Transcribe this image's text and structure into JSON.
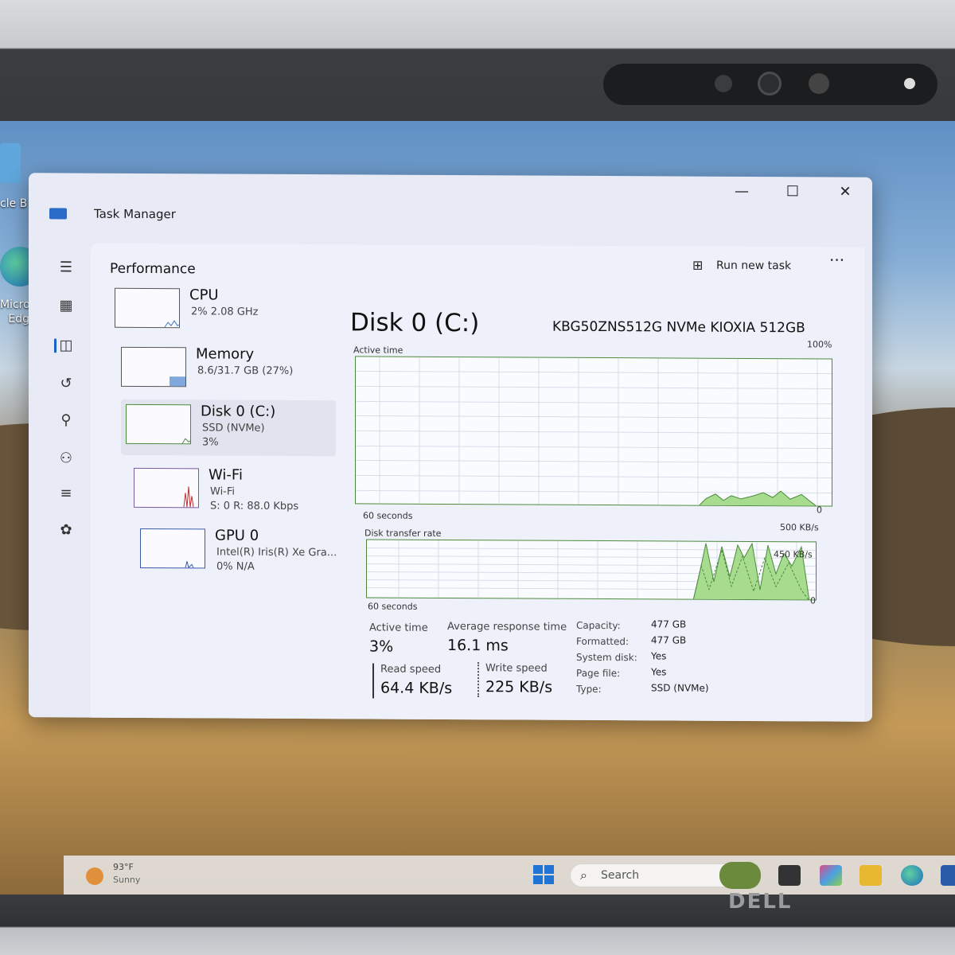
{
  "window": {
    "title": "Task Manager",
    "minimize": "—",
    "maximize": "☐",
    "close": "✕"
  },
  "desktop": {
    "icons": [
      {
        "label": "cle B"
      },
      {
        "label": "Microsoft Edge"
      }
    ]
  },
  "header": {
    "page_title": "Performance",
    "run_new_task": "Run new task",
    "more": "···"
  },
  "nav": {
    "icons": [
      "menu-icon",
      "processes-icon",
      "performance-icon",
      "app-history-icon",
      "startup-apps-icon",
      "users-icon",
      "details-icon",
      "services-icon",
      "settings-icon"
    ]
  },
  "resources": [
    {
      "name": "CPU",
      "sub1": "2%  2.08 GHz",
      "sub2": ""
    },
    {
      "name": "Memory",
      "sub1": "8.6/31.7 GB (27%)",
      "sub2": ""
    },
    {
      "name": "Disk 0 (C:)",
      "sub1": "SSD (NVMe)",
      "sub2": "3%"
    },
    {
      "name": "Wi-Fi",
      "sub1": "Wi-Fi",
      "sub2": "S: 0  R: 88.0 Kbps"
    },
    {
      "name": "GPU 0",
      "sub1": "Intel(R) Iris(R) Xe Gra...",
      "sub2": "0%  N/A"
    }
  ],
  "detail": {
    "title": "Disk 0 (C:)",
    "model": "KBG50ZNS512G NVMe KIOXIA 512GB",
    "active_time_graph": {
      "label": "Active time",
      "max": "100%",
      "duration": "60 seconds",
      "min": "0"
    },
    "transfer_graph": {
      "label": "Disk transfer rate",
      "max": "500 KB/s",
      "mid": "450 KB/s",
      "duration": "60 seconds",
      "min": "0"
    },
    "stats": {
      "active_time_label": "Active time",
      "active_time_value": "3%",
      "avg_response_label": "Average response time",
      "avg_response_value": "16.1 ms",
      "read_speed_label": "Read speed",
      "read_speed_value": "64.4 KB/s",
      "write_speed_label": "Write speed",
      "write_speed_value": "225 KB/s"
    },
    "properties": [
      {
        "label": "Capacity:",
        "value": "477 GB"
      },
      {
        "label": "Formatted:",
        "value": "477 GB"
      },
      {
        "label": "System disk:",
        "value": "Yes"
      },
      {
        "label": "Page file:",
        "value": "Yes"
      },
      {
        "label": "Type:",
        "value": "SSD (NVMe)"
      }
    ]
  },
  "taskbar": {
    "weather_temp": "93°F",
    "weather_condition": "Sunny",
    "search_label": "Search"
  },
  "brand": "DELL",
  "colors": {
    "accent": "#1e5fc4",
    "graph_line": "#4b8a3c",
    "graph_fill": "#a7dc8f"
  }
}
